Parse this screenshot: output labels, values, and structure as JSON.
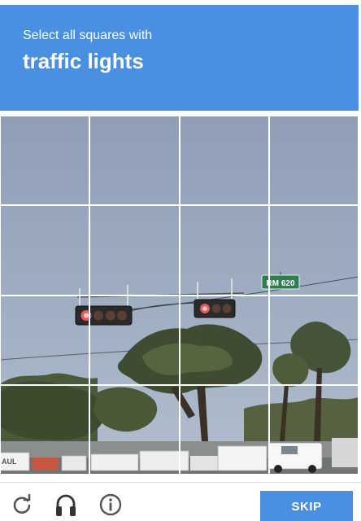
{
  "challenge": {
    "instruction": "Select all squares with",
    "target": "traffic lights"
  },
  "image": {
    "road_sign_text": "RM 620",
    "truck_text": "AUL"
  },
  "grid": {
    "rows": 4,
    "columns": 4
  },
  "footer": {
    "reload_icon": "reload-icon",
    "audio_icon": "headphones-icon",
    "info_icon": "info-icon",
    "skip_label": "SKIP"
  },
  "colors": {
    "accent": "#4a90e2",
    "divider": "#dfdfdf"
  }
}
